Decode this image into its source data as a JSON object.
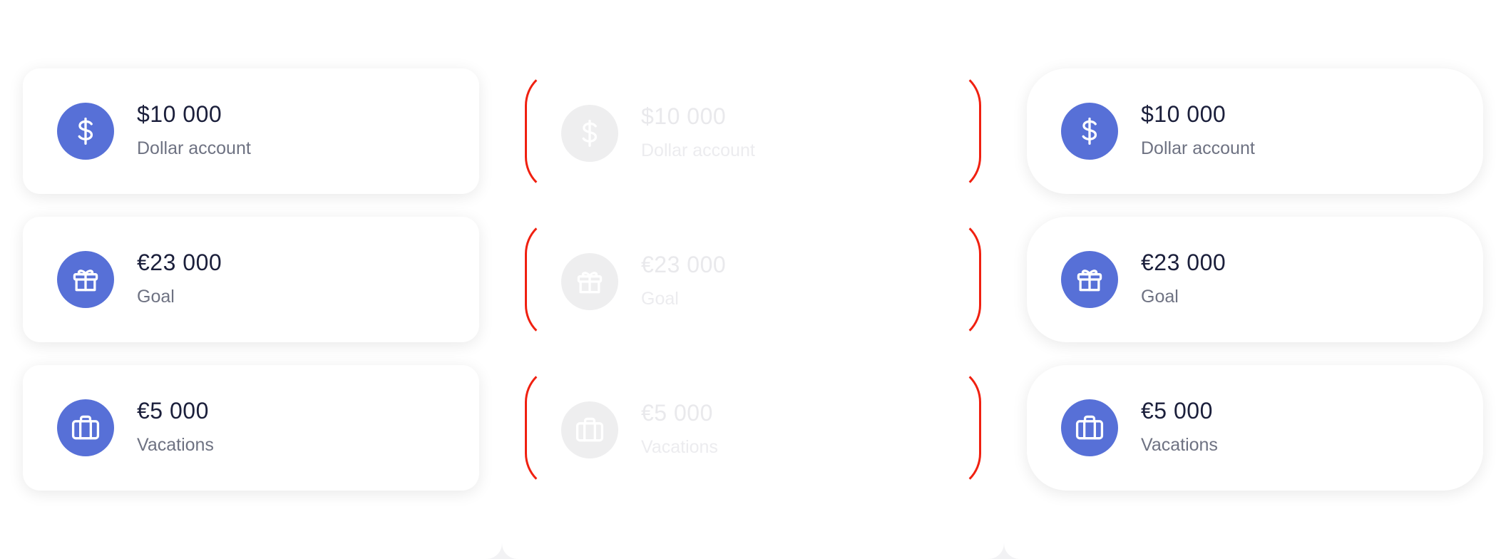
{
  "colors": {
    "accent": "#5770d7",
    "ghost_icon": "#eeeeef",
    "outline_red": "#f02010",
    "amount_text": "#1b1f3b",
    "label_text": "#6e7282"
  },
  "variants": [
    {
      "name": "default",
      "cards": [
        {
          "icon": "dollar-icon",
          "amount": "$10 000",
          "label": "Dollar account"
        },
        {
          "icon": "gift-icon",
          "amount": "€23 000",
          "label": "Goal"
        },
        {
          "icon": "briefcase-icon",
          "amount": "€5 000",
          "label": "Vacations"
        }
      ]
    },
    {
      "name": "ghost",
      "cards": [
        {
          "icon": "dollar-icon",
          "amount": "$10 000",
          "label": "Dollar account"
        },
        {
          "icon": "gift-icon",
          "amount": "€23 000",
          "label": "Goal"
        },
        {
          "icon": "briefcase-icon",
          "amount": "€5 000",
          "label": "Vacations"
        }
      ]
    },
    {
      "name": "rounded",
      "cards": [
        {
          "icon": "dollar-icon",
          "amount": "$10 000",
          "label": "Dollar account"
        },
        {
          "icon": "gift-icon",
          "amount": "€23 000",
          "label": "Goal"
        },
        {
          "icon": "briefcase-icon",
          "amount": "€5 000",
          "label": "Vacations"
        }
      ]
    }
  ]
}
